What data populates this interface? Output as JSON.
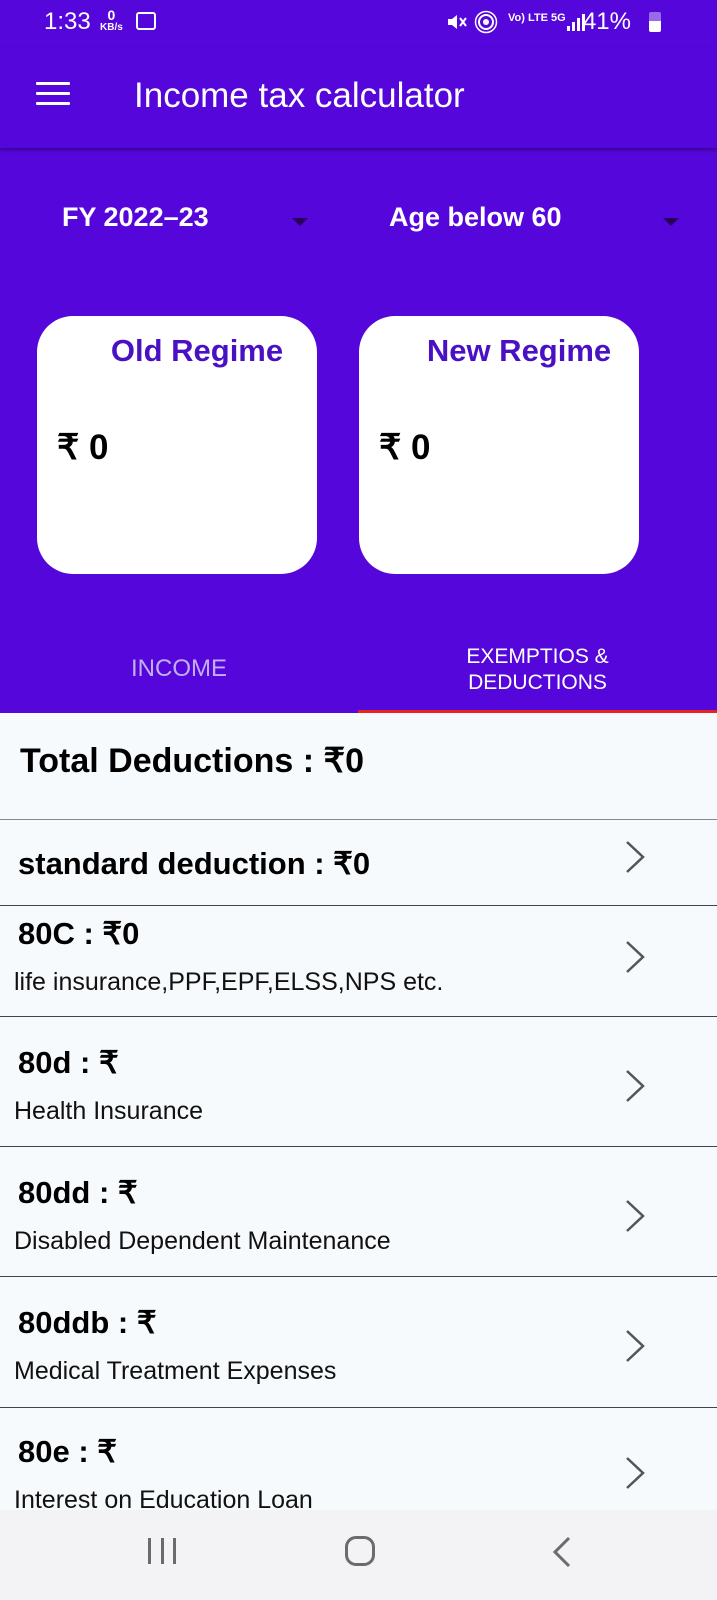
{
  "status_bar": {
    "time": "1:33",
    "net_speed_value": "0",
    "net_speed_unit": "KB/s",
    "network_label": "Vo) LTE 5G",
    "battery": "41%"
  },
  "app_bar": {
    "menu_icon": "hamburger-menu-icon",
    "title": "Income tax calculator"
  },
  "selectors": {
    "fy": "FY 2022–23",
    "age": "Age below 60"
  },
  "regimes": {
    "old": {
      "title": "Old Regime",
      "amount": "₹ 0"
    },
    "new": {
      "title": "New Regime",
      "amount": "₹ 0"
    }
  },
  "tabs": {
    "income": "INCOME",
    "deductions_line1": "EXEMPTIOS &",
    "deductions_line2": "DEDUCTIONS",
    "active": "deductions"
  },
  "total_deductions": "Total Deductions :  ₹0",
  "deduction_rows": [
    {
      "head": "standard deduction : ₹0",
      "sub": ""
    },
    {
      "head": "80C : ₹0",
      "sub": "life insurance,PPF,EPF,ELSS,NPS etc."
    },
    {
      "head": "80d : ₹",
      "sub": "Health Insurance"
    },
    {
      "head": "80dd : ₹",
      "sub": "Disabled Dependent Maintenance"
    },
    {
      "head": "80ddb : ₹",
      "sub": "Medical Treatment Expenses"
    },
    {
      "head": "80e : ₹",
      "sub": "Interest on Education Loan"
    }
  ],
  "colors": {
    "primary": "#5506db",
    "card_title": "#4a10c4",
    "tab_indicator": "#e62222",
    "inactive_tab": "#c2aef0"
  }
}
